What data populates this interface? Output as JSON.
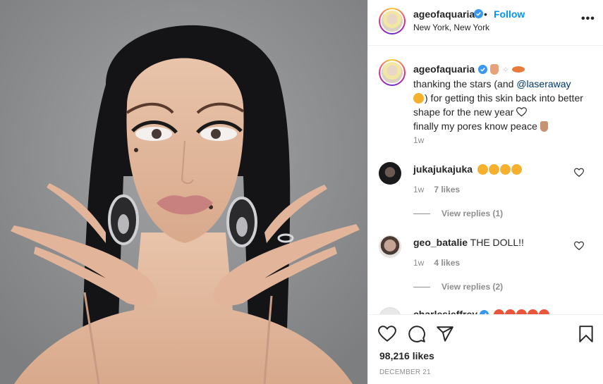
{
  "post": {
    "username": "ageofaquaria",
    "follow_label": "Follow",
    "separator": "•",
    "location": "New York, New York",
    "more_label": "•••"
  },
  "caption": {
    "username": "ageofaquaria",
    "line1": "thanking the stars (and ",
    "mention": "@laseraway",
    "line2": ") for getting this skin back into better shape for the new year ",
    "line3": "finally my pores know peace ",
    "time": "1w"
  },
  "comments": [
    {
      "username": "jukajukajuka",
      "text": "",
      "time": "1w",
      "likes": "7 likes",
      "replies": "View replies (1)"
    },
    {
      "username": "geo_batalie",
      "text": "THE DOLL!!",
      "time": "1w",
      "likes": "4 likes",
      "replies": "View replies (2)"
    },
    {
      "username": "charlesjeffrey",
      "text": ""
    }
  ],
  "footer": {
    "likes": "98,216 likes",
    "date": "DECEMBER 21"
  },
  "colors": {
    "follow": "#0095f6",
    "verified": "#3897f0",
    "mention": "#00376b",
    "heart_eyes": "#f5b02e"
  },
  "icons": [
    "verified-badge-icon",
    "more-options-icon",
    "heart-icon",
    "comment-icon",
    "share-icon",
    "bookmark-icon"
  ]
}
